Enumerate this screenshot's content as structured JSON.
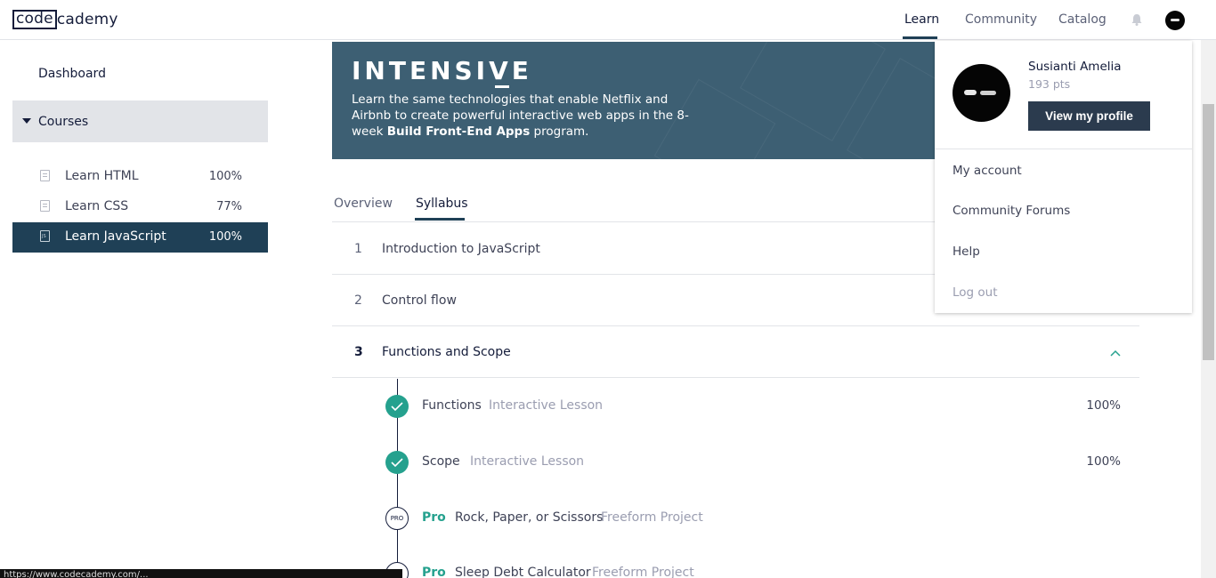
{
  "header": {
    "logo_box": "code",
    "logo_rest": "cademy",
    "nav": {
      "learn": "Learn",
      "community": "Community",
      "catalog": "Catalog"
    }
  },
  "sidebar": {
    "dashboard": "Dashboard",
    "courses_label": "Courses",
    "courses": [
      {
        "name": "Learn HTML",
        "progress": "100%"
      },
      {
        "name": "Learn CSS",
        "progress": "77%"
      },
      {
        "name": "Learn JavaScript",
        "progress": "100%",
        "active": true,
        "icon_text": "JS"
      }
    ]
  },
  "banner": {
    "title": "INTENSIVE",
    "desc_plain": "Learn the same technologies that enable Netflix and Airbnb to create powerful interactive web apps in the 8-week ",
    "desc_bold": "Build Front-End Apps",
    "desc_end": " program."
  },
  "tabs": {
    "overview": "Overview",
    "syllabus": "Syllabus"
  },
  "syllabus": {
    "units": [
      {
        "num": "1",
        "name": "Introduction to JavaScript"
      },
      {
        "num": "2",
        "name": "Control flow"
      },
      {
        "num": "3",
        "name": "Functions and Scope"
      }
    ],
    "lessons": [
      {
        "name": "Functions",
        "type": "Interactive Lesson",
        "progress": "100%"
      },
      {
        "name": "Scope",
        "type": "Interactive Lesson",
        "progress": "100%"
      },
      {
        "pro": "Pro",
        "badge": "PRO",
        "name": "Rock, Paper, or Scissors",
        "type": "Freeform Project"
      },
      {
        "pro": "Pro",
        "name": "Sleep Debt Calculator",
        "type": "Freeform Project"
      }
    ]
  },
  "profile_menu": {
    "name": "Susianti Amelia",
    "points": "193 pts",
    "view_profile": "View my profile",
    "items": [
      "My account",
      "Community Forums",
      "Help",
      "Log out"
    ]
  },
  "statusbar": {
    "url": "https://www.codecademy.com/..."
  },
  "colors": {
    "navy": "#1f4056",
    "teal": "#25a18e",
    "banner": "#3d5f73"
  }
}
